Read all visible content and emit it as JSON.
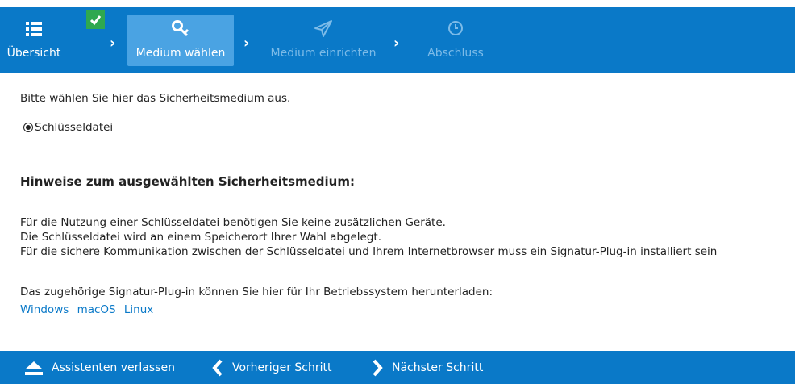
{
  "wizard": {
    "steps": [
      {
        "label": "Übersicht",
        "icon": "list-icon",
        "state": "done"
      },
      {
        "label": "Medium wählen",
        "icon": "key-icon",
        "state": "active"
      },
      {
        "label": "Medium einrichten",
        "icon": "paper-plane-icon",
        "state": "disabled"
      },
      {
        "label": "Abschluss",
        "icon": "clock-icon",
        "state": "disabled"
      }
    ],
    "colors": {
      "bar": "#0a79c8",
      "active": "#4aa3e3",
      "check": "#2fa84f"
    }
  },
  "main": {
    "intro": "Bitte wählen Sie hier das Sicherheitsmedium aus.",
    "option_label": "Schlüsseldatei",
    "heading": "Hinweise zum ausgewählten Sicherheitsmedium:",
    "lines": [
      "Für die Nutzung einer Schlüsseldatei benötigen Sie keine zusätzlichen Geräte.",
      "Die Schlüsseldatei wird an einem Speicherort Ihrer Wahl abgelegt.",
      "Für die sichere Kommunikation zwischen der Schlüsseldatei und Ihrem Internetbrowser muss ein Signatur-Plug-in installiert sein"
    ],
    "download_text": "Das zugehörige Signatur-Plug-in können Sie hier für Ihr Betriebssystem herunterladen:",
    "links": [
      "Windows",
      "macOS",
      "Linux"
    ]
  },
  "footer": {
    "exit": "Assistenten verlassen",
    "prev": "Vorheriger Schritt",
    "next": "Nächster Schritt"
  }
}
